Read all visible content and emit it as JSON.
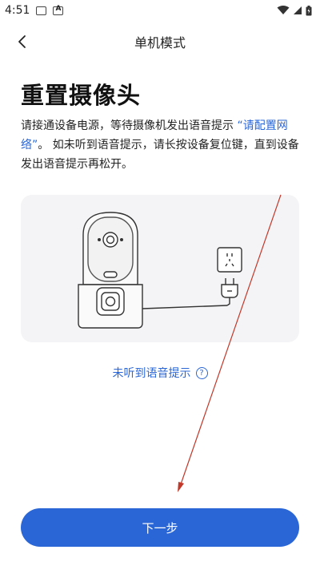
{
  "status_bar": {
    "time": "4:51"
  },
  "header": {
    "title": "单机模式"
  },
  "main": {
    "title": "重置摄像头",
    "description_part1": "请接通设备电源，等待摄像机发出语音提示 ",
    "description_link": "“请配置网络”",
    "description_part2": "。 如未听到语音提示，请长按设备复位键，直到设备发出语音提示再松开。",
    "help_link": "未听到语音提示",
    "help_icon": "question-circle-icon"
  },
  "footer": {
    "next_label": "下一步"
  },
  "colors": {
    "accent": "#2a66d6",
    "annotation_arrow": "#c0392b"
  }
}
